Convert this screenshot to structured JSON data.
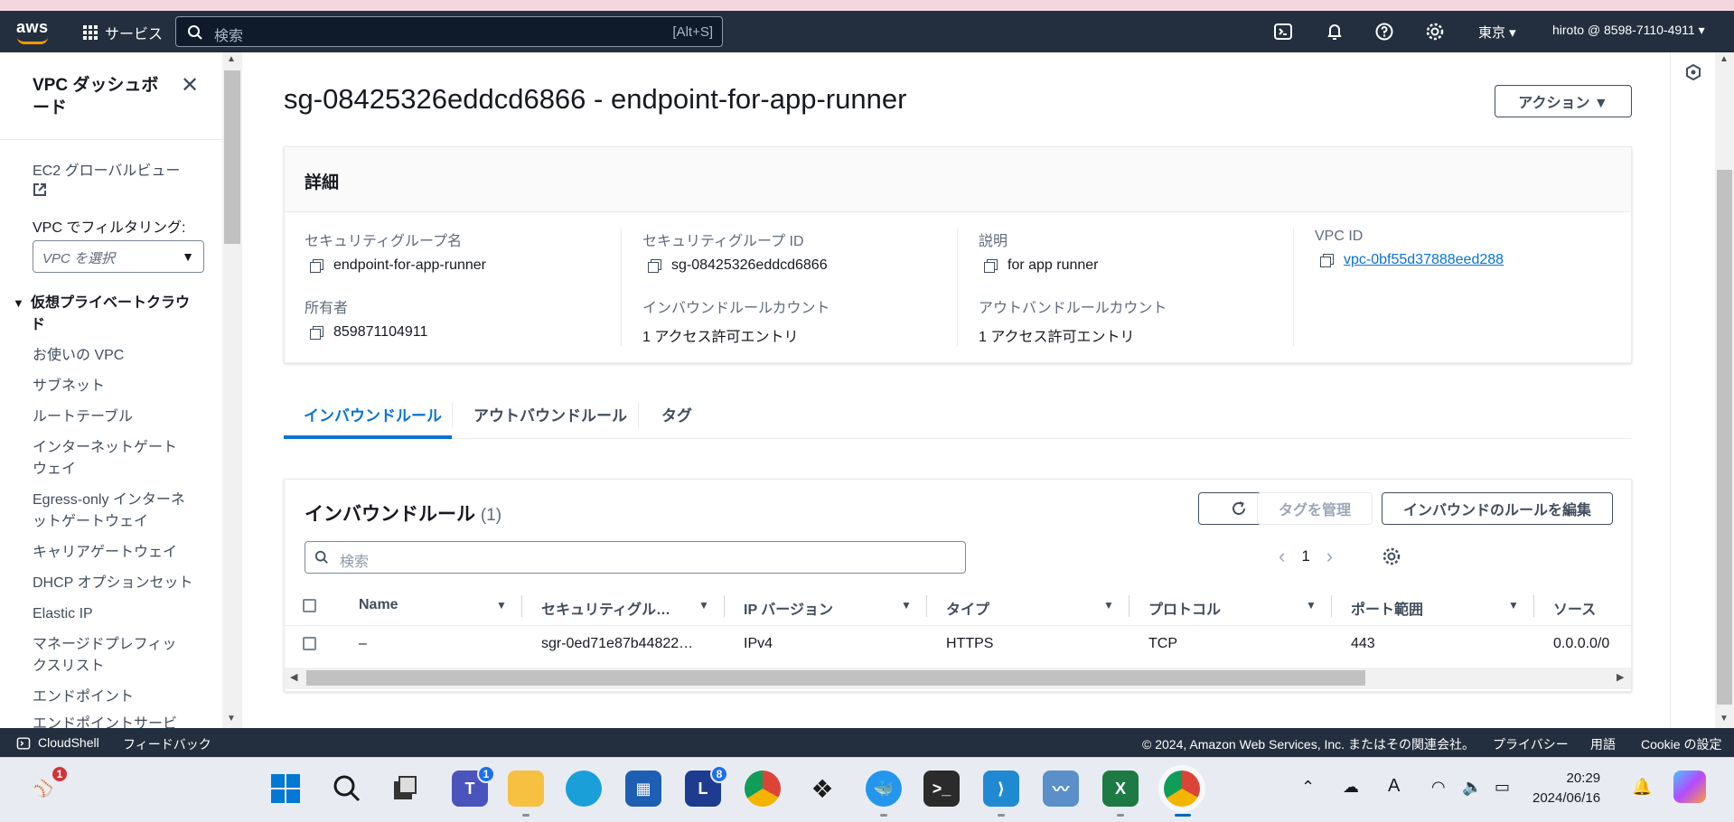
{
  "topnav": {
    "logo": "aws",
    "services_label": "サービス",
    "search_placeholder": "検索",
    "search_shortcut": "[Alt+S]",
    "region": "東京 ▾",
    "user": "hiroto @ 8598-7110-4911 ▾",
    "icons": [
      "cloudshell-icon",
      "bell-icon",
      "help-icon",
      "gear-icon"
    ]
  },
  "sidebar": {
    "title": "VPC ダッシュボード",
    "ec2_link": "EC2 グローバルビュー",
    "filter_label": "VPC でフィルタリング:",
    "filter_placeholder": "VPC を選択",
    "section": "仮想プライベートクラウド",
    "items": [
      "お使いの VPC",
      "サブネット",
      "ルートテーブル",
      "インターネットゲートウェイ",
      "Egress-only インターネットゲートウェイ",
      "キャリアゲートウェイ",
      "DHCP オプションセット",
      "Elastic IP",
      "マネージドプレフィックスリスト",
      "エンドポイント",
      "エンドポイントサービス"
    ]
  },
  "main": {
    "title": "sg-08425326eddcd6866 - endpoint-for-app-runner",
    "actions_button": "アクション ▼",
    "details": {
      "header": "詳細",
      "sg_name_label": "セキュリティグループ名",
      "sg_name": "endpoint-for-app-runner",
      "sg_id_label": "セキュリティグループ ID",
      "sg_id": "sg-08425326eddcd6866",
      "desc_label": "説明",
      "desc": "for app runner",
      "vpc_label": "VPC ID",
      "vpc": "vpc-0bf55d37888eed288",
      "owner_label": "所有者",
      "owner": "859871104911",
      "inbound_count_label": "インバウンドルールカウント",
      "inbound_count": "1 アクセス許可エントリ",
      "outbound_count_label": "アウトバンドルールカウント",
      "outbound_count": "1 アクセス許可エントリ"
    },
    "tabs": [
      "インバウンドルール",
      "アウトバウンドルール",
      "タグ"
    ],
    "rules": {
      "title": "インバウンドルール",
      "count": "(1)",
      "manage_tags": "タグを管理",
      "edit_rules": "インバウンドのルールを編集",
      "search_placeholder": "検索",
      "page": "1",
      "columns": [
        "Name",
        "セキュリティグル…",
        "IP バージョン",
        "タイプ",
        "プロトコル",
        "ポート範囲",
        "ソース"
      ],
      "rows": [
        {
          "name": "–",
          "rule_id": "sgr-0ed71e87b44822…",
          "ip": "IPv4",
          "type": "HTTPS",
          "protocol": "TCP",
          "port": "443",
          "source": "0.0.0.0/0"
        }
      ]
    }
  },
  "footer": {
    "cloudshell": "CloudShell",
    "feedback": "フィードバック",
    "copyright": "© 2024, Amazon Web Services, Inc. またはその関連会社。",
    "privacy": "プライバシー",
    "terms": "用語",
    "cookie": "Cookie の設定"
  },
  "taskbar": {
    "time": "20:29",
    "date": "2024/06/16",
    "badges": {
      "teams": "1",
      "l_app": "8",
      "left": "1"
    }
  }
}
